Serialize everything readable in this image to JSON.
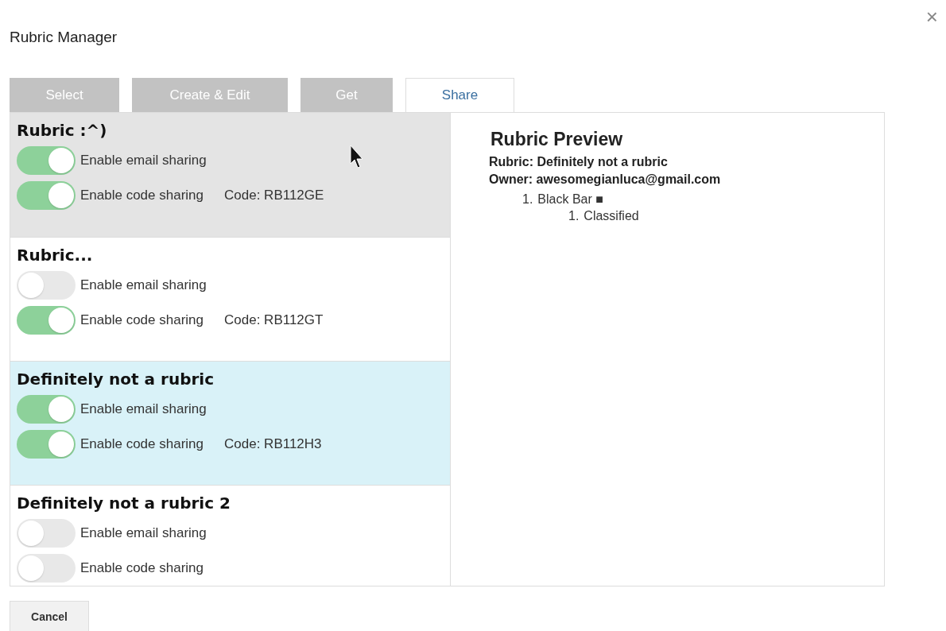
{
  "dialog": {
    "title": "Rubric Manager",
    "close": "×"
  },
  "tabs": [
    {
      "label": "Select",
      "selected": false
    },
    {
      "label": "Create & Edit",
      "selected": false
    },
    {
      "label": "Get",
      "selected": false
    },
    {
      "label": "Share",
      "selected": true
    }
  ],
  "rubrics": [
    {
      "name": "Rubric :^)",
      "hovered": true,
      "selected": false,
      "email_sharing": true,
      "code_sharing": true,
      "code": "Code: RB112GE",
      "email_label": "Enable email sharing",
      "code_label": "Enable code sharing"
    },
    {
      "name": "Rubric...",
      "hovered": false,
      "selected": false,
      "email_sharing": false,
      "code_sharing": true,
      "code": "Code: RB112GT",
      "email_label": "Enable email sharing",
      "code_label": "Enable code sharing"
    },
    {
      "name": "Definitely not a rubric",
      "hovered": false,
      "selected": true,
      "email_sharing": true,
      "code_sharing": true,
      "code": "Code: RB112H3",
      "email_label": "Enable email sharing",
      "code_label": "Enable code sharing"
    },
    {
      "name": "Definitely not a rubric 2",
      "hovered": false,
      "selected": false,
      "email_sharing": false,
      "code_sharing": false,
      "email_label": "Enable email sharing",
      "code_label": "Enable code sharing"
    }
  ],
  "preview": {
    "title": "Rubric Preview",
    "rubric": "Rubric: Definitely not a rubric",
    "owner": "Owner: awesomegianluca@gmail.com",
    "items": [
      {
        "number": "1.",
        "label": "Black Bar ■",
        "children": [
          {
            "number": "1.",
            "label": "Classified"
          }
        ]
      }
    ]
  },
  "buttons": [
    "Cancel"
  ]
}
